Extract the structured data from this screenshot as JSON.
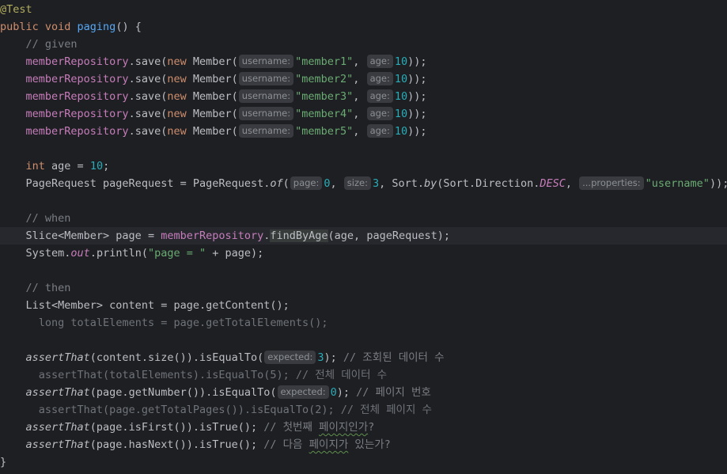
{
  "editor": {
    "lines": [
      {
        "indent": "",
        "tokens": [
          {
            "t": "@Test",
            "c": "ann"
          }
        ]
      },
      {
        "indent": "",
        "tokens": [
          {
            "t": "public void ",
            "c": "kw"
          },
          {
            "t": "paging",
            "c": "fn"
          },
          {
            "t": "() {",
            "c": ""
          }
        ]
      },
      {
        "indent": "    ",
        "tokens": [
          {
            "t": "// given",
            "c": "cm"
          }
        ]
      },
      {
        "indent": "    ",
        "tokens": [
          {
            "t": "memberRepository",
            "c": "field"
          },
          {
            "t": ".save(",
            "c": ""
          },
          {
            "t": "new ",
            "c": "kw"
          },
          {
            "t": "Member(",
            "c": ""
          },
          {
            "t": "username:",
            "c": "hint"
          },
          {
            "t": "\"member1\"",
            "c": "str"
          },
          {
            "t": ", ",
            "c": ""
          },
          {
            "t": "age:",
            "c": "hint"
          },
          {
            "t": "10",
            "c": "num"
          },
          {
            "t": "));",
            "c": ""
          }
        ]
      },
      {
        "indent": "    ",
        "tokens": [
          {
            "t": "memberRepository",
            "c": "field"
          },
          {
            "t": ".save(",
            "c": ""
          },
          {
            "t": "new ",
            "c": "kw"
          },
          {
            "t": "Member(",
            "c": ""
          },
          {
            "t": "username:",
            "c": "hint"
          },
          {
            "t": "\"member2\"",
            "c": "str"
          },
          {
            "t": ", ",
            "c": ""
          },
          {
            "t": "age:",
            "c": "hint"
          },
          {
            "t": "10",
            "c": "num"
          },
          {
            "t": "));",
            "c": ""
          }
        ]
      },
      {
        "indent": "    ",
        "tokens": [
          {
            "t": "memberRepository",
            "c": "field"
          },
          {
            "t": ".save(",
            "c": ""
          },
          {
            "t": "new ",
            "c": "kw"
          },
          {
            "t": "Member(",
            "c": ""
          },
          {
            "t": "username:",
            "c": "hint"
          },
          {
            "t": "\"member3\"",
            "c": "str"
          },
          {
            "t": ", ",
            "c": ""
          },
          {
            "t": "age:",
            "c": "hint"
          },
          {
            "t": "10",
            "c": "num"
          },
          {
            "t": "));",
            "c": ""
          }
        ]
      },
      {
        "indent": "    ",
        "tokens": [
          {
            "t": "memberRepository",
            "c": "field"
          },
          {
            "t": ".save(",
            "c": ""
          },
          {
            "t": "new ",
            "c": "kw"
          },
          {
            "t": "Member(",
            "c": ""
          },
          {
            "t": "username:",
            "c": "hint"
          },
          {
            "t": "\"member4\"",
            "c": "str"
          },
          {
            "t": ", ",
            "c": ""
          },
          {
            "t": "age:",
            "c": "hint"
          },
          {
            "t": "10",
            "c": "num"
          },
          {
            "t": "));",
            "c": ""
          }
        ]
      },
      {
        "indent": "    ",
        "tokens": [
          {
            "t": "memberRepository",
            "c": "field"
          },
          {
            "t": ".save(",
            "c": ""
          },
          {
            "t": "new ",
            "c": "kw"
          },
          {
            "t": "Member(",
            "c": ""
          },
          {
            "t": "username:",
            "c": "hint"
          },
          {
            "t": "\"member5\"",
            "c": "str"
          },
          {
            "t": ", ",
            "c": ""
          },
          {
            "t": "age:",
            "c": "hint"
          },
          {
            "t": "10",
            "c": "num"
          },
          {
            "t": "));",
            "c": ""
          }
        ]
      },
      {
        "indent": "",
        "tokens": []
      },
      {
        "indent": "    ",
        "tokens": [
          {
            "t": "int ",
            "c": "kw"
          },
          {
            "t": "age = ",
            "c": ""
          },
          {
            "t": "10",
            "c": "num"
          },
          {
            "t": ";",
            "c": ""
          }
        ]
      },
      {
        "indent": "    ",
        "tokens": [
          {
            "t": "PageRequest pageRequest = PageRequest.",
            "c": ""
          },
          {
            "t": "of",
            "c": "static"
          },
          {
            "t": "(",
            "c": ""
          },
          {
            "t": "page:",
            "c": "hint"
          },
          {
            "t": "0",
            "c": "num"
          },
          {
            "t": ", ",
            "c": ""
          },
          {
            "t": "size:",
            "c": "hint"
          },
          {
            "t": "3",
            "c": "num"
          },
          {
            "t": ", Sort.",
            "c": ""
          },
          {
            "t": "by",
            "c": "static"
          },
          {
            "t": "(Sort.Direction.",
            "c": ""
          },
          {
            "t": "DESC",
            "c": "const"
          },
          {
            "t": ", ",
            "c": ""
          },
          {
            "t": "...properties:",
            "c": "hint"
          },
          {
            "t": "\"username\"",
            "c": "str"
          },
          {
            "t": "));",
            "c": ""
          }
        ]
      },
      {
        "indent": "",
        "tokens": []
      },
      {
        "indent": "    ",
        "tokens": [
          {
            "t": "// when",
            "c": "cm"
          }
        ]
      },
      {
        "indent": "    ",
        "current": true,
        "tokens": [
          {
            "t": "Slice<Member> page = ",
            "c": ""
          },
          {
            "t": "memberRepository",
            "c": "field"
          },
          {
            "t": ".",
            "c": ""
          },
          {
            "t": "findByAge",
            "c": "hl"
          },
          {
            "t": "(age, pageRequest);",
            "c": ""
          }
        ]
      },
      {
        "indent": "    ",
        "tokens": [
          {
            "t": "System.",
            "c": ""
          },
          {
            "t": "out",
            "c": "const"
          },
          {
            "t": ".println(",
            "c": ""
          },
          {
            "t": "\"page = \"",
            "c": "str"
          },
          {
            "t": " + page);",
            "c": ""
          }
        ]
      },
      {
        "indent": "",
        "tokens": []
      },
      {
        "indent": "    ",
        "tokens": [
          {
            "t": "// then",
            "c": "cm"
          }
        ]
      },
      {
        "indent": "    ",
        "tokens": [
          {
            "t": "List<Member> content = page.getContent();",
            "c": ""
          }
        ]
      },
      {
        "indent": "      ",
        "tokens": [
          {
            "t": "long totalElements = page.getTotalElements();",
            "c": "dim"
          }
        ]
      },
      {
        "indent": "",
        "tokens": []
      },
      {
        "indent": "    ",
        "tokens": [
          {
            "t": "assertThat",
            "c": "static"
          },
          {
            "t": "(content.size()).isEqualTo(",
            "c": ""
          },
          {
            "t": "expected:",
            "c": "hint"
          },
          {
            "t": "3",
            "c": "num"
          },
          {
            "t": "); ",
            "c": ""
          },
          {
            "t": "// 조회된 데이터 수",
            "c": "cm"
          }
        ]
      },
      {
        "indent": "      ",
        "tokens": [
          {
            "t": "assertThat(totalElements).isEqualTo(5); // 전체 데이터 수",
            "c": "dim"
          }
        ]
      },
      {
        "indent": "    ",
        "tokens": [
          {
            "t": "assertThat",
            "c": "static"
          },
          {
            "t": "(page.getNumber()).isEqualTo(",
            "c": ""
          },
          {
            "t": "expected:",
            "c": "hint"
          },
          {
            "t": "0",
            "c": "num"
          },
          {
            "t": "); ",
            "c": ""
          },
          {
            "t": "// 페이지 번호",
            "c": "cm"
          }
        ]
      },
      {
        "indent": "      ",
        "tokens": [
          {
            "t": "assertThat(page.getTotalPages()).isEqualTo(2); // 전체 페이지 수",
            "c": "dim"
          }
        ]
      },
      {
        "indent": "    ",
        "tokens": [
          {
            "t": "assertThat",
            "c": "static"
          },
          {
            "t": "(page.isFirst()).isTrue(); ",
            "c": ""
          },
          {
            "t": "// 첫번째 ",
            "c": "cm"
          },
          {
            "t": "페이지인가",
            "c": "cm squig"
          },
          {
            "t": "?",
            "c": "cm"
          }
        ]
      },
      {
        "indent": "    ",
        "tokens": [
          {
            "t": "assertThat",
            "c": "static"
          },
          {
            "t": "(page.hasNext()).isTrue(); ",
            "c": ""
          },
          {
            "t": "// 다음 ",
            "c": "cm"
          },
          {
            "t": "페이지가",
            "c": "cm squig"
          },
          {
            "t": " 있는가?",
            "c": "cm"
          }
        ]
      },
      {
        "indent": "",
        "tokens": [
          {
            "t": "}",
            "c": ""
          }
        ]
      }
    ]
  }
}
